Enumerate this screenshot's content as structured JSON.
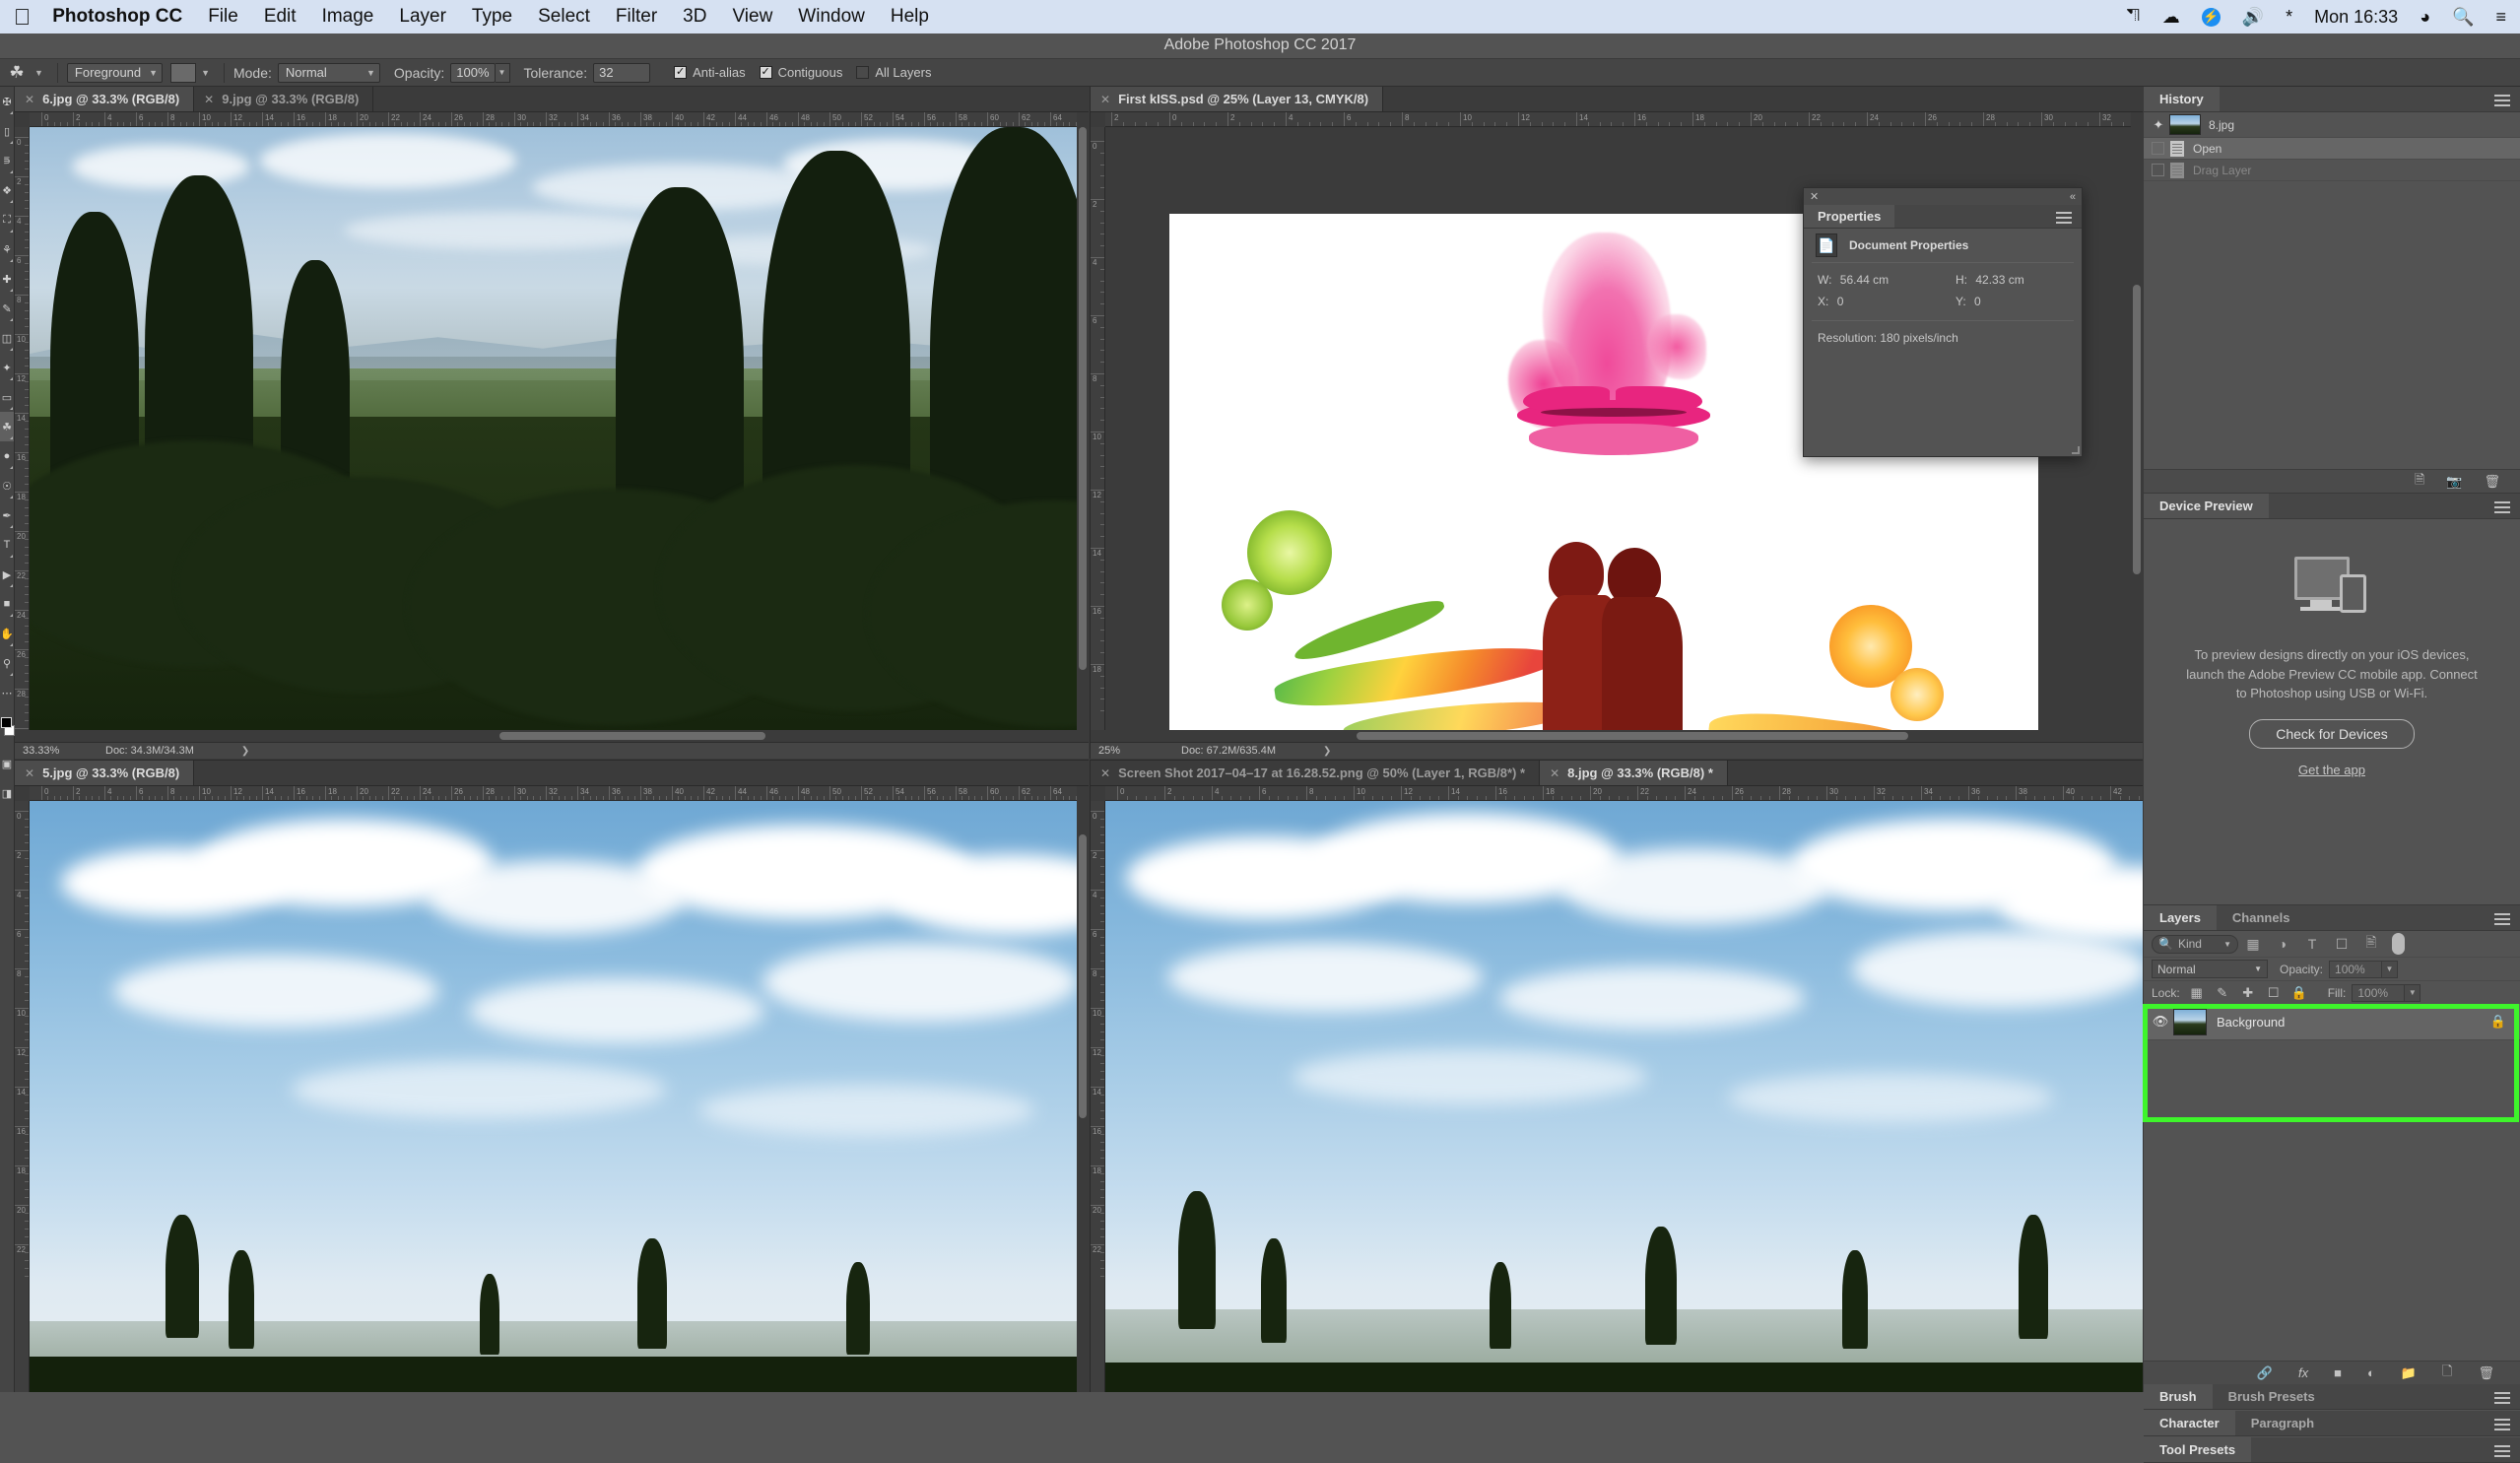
{
  "macbar": {
    "apple_icon": "apple-icon",
    "app_name": "Photoshop CC",
    "menus": [
      "File",
      "Edit",
      "Image",
      "Layer",
      "Type",
      "Select",
      "Filter",
      "3D",
      "View",
      "Window",
      "Help"
    ],
    "status_icons": [
      "do-not-disturb-icon",
      "creative-cloud-icon",
      "bolt-icon",
      "volume-icon",
      "bluetooth-icon"
    ],
    "time": "Mon 16:33",
    "right_icons": [
      "wifi-icon",
      "search-icon",
      "control-center-icon"
    ]
  },
  "titlebar": {
    "title": "Adobe Photoshop CC 2017"
  },
  "options_bar": {
    "tool_icon": "paint-bucket-icon",
    "fill_source": "Foreground",
    "mode_label": "Mode:",
    "mode_value": "Normal",
    "opacity_label": "Opacity:",
    "opacity_value": "100%",
    "tolerance_label": "Tolerance:",
    "tolerance_value": "32",
    "checkboxes": [
      {
        "label": "Anti-alias",
        "checked": true
      },
      {
        "label": "Contiguous",
        "checked": true
      },
      {
        "label": "All Layers",
        "checked": false
      }
    ]
  },
  "toolbar": {
    "tools": [
      "move-tool",
      "marquee-tool",
      "lasso-tool",
      "quick-selection-tool",
      "crop-tool",
      "eyedropper-tool",
      "healing-brush-tool",
      "brush-tool",
      "clone-stamp-tool",
      "history-brush-tool",
      "eraser-tool",
      "gradient-tool",
      "blur-tool",
      "dodge-tool",
      "pen-tool",
      "type-tool",
      "path-selection-tool",
      "shape-tool",
      "hand-tool",
      "zoom-tool"
    ],
    "selected_tool": "paint-bucket-tool",
    "foreground_color": "#000000",
    "background_color": "#ffffff"
  },
  "documents": {
    "group_tl": {
      "tabs": [
        {
          "label": "6.jpg @ 33.3% (RGB/8)",
          "active": true
        },
        {
          "label": "9.jpg @ 33.3% (RGB/8)",
          "active": false
        }
      ],
      "status": {
        "zoom": "33.33%",
        "doc": "Doc: 34.3M/34.3M"
      },
      "ruler_h": [
        "0",
        "2",
        "4",
        "6",
        "8",
        "10",
        "12",
        "14",
        "16",
        "18",
        "20",
        "22",
        "24",
        "26",
        "28",
        "30",
        "32",
        "34",
        "36",
        "38",
        "40",
        "42",
        "44",
        "46",
        "48",
        "50",
        "52",
        "54",
        "56",
        "58",
        "60",
        "62",
        "64"
      ],
      "ruler_v": [
        "0",
        "2",
        "4",
        "6",
        "8",
        "10",
        "12",
        "14",
        "16",
        "18",
        "20",
        "22",
        "24",
        "26",
        "28",
        "30"
      ]
    },
    "group_tr": {
      "tabs": [
        {
          "label": "First kISS.psd @ 25% (Layer 13, CMYK/8)",
          "active": true
        }
      ],
      "status": {
        "zoom": "25%",
        "doc": "Doc: 67.2M/635.4M"
      },
      "ruler_h": [
        "2",
        "0",
        "2",
        "4",
        "6",
        "8",
        "10",
        "12",
        "14",
        "16",
        "18",
        "20",
        "22",
        "24",
        "26",
        "28",
        "30",
        "32"
      ],
      "ruler_v": [
        "0",
        "2",
        "4",
        "6",
        "8",
        "10",
        "12",
        "14",
        "16",
        "18"
      ]
    },
    "group_bl": {
      "tabs": [
        {
          "label": "5.jpg @ 33.3% (RGB/8)",
          "active": true
        }
      ],
      "ruler_h": [
        "0",
        "2",
        "4",
        "6",
        "8",
        "10",
        "12",
        "14",
        "16",
        "18",
        "20",
        "22",
        "24",
        "26",
        "28",
        "30",
        "32",
        "34",
        "36",
        "38",
        "40",
        "42",
        "44",
        "46",
        "48",
        "50",
        "52",
        "54",
        "56",
        "58",
        "60",
        "62",
        "64"
      ],
      "ruler_v": [
        "0",
        "2",
        "4",
        "6",
        "8",
        "10",
        "12",
        "14",
        "16",
        "18",
        "20",
        "22"
      ]
    },
    "group_br": {
      "tabs": [
        {
          "label": "Screen Shot 2017–04–17 at 16.28.52.png @ 50% (Layer 1, RGB/8*) *",
          "active": false
        },
        {
          "label": "8.jpg @ 33.3% (RGB/8) *",
          "active": true
        }
      ],
      "ruler_h": [
        "0",
        "2",
        "4",
        "6",
        "8",
        "10",
        "12",
        "14",
        "16",
        "18",
        "20",
        "22",
        "24",
        "26",
        "28",
        "30",
        "32",
        "34",
        "36",
        "38",
        "40",
        "42"
      ],
      "ruler_v": [
        "0",
        "2",
        "4",
        "6",
        "8",
        "10",
        "12",
        "14",
        "16",
        "18",
        "20",
        "22"
      ]
    }
  },
  "properties_panel": {
    "close_icon": "close-icon",
    "collapse_icon": "collapse-icon",
    "tab_label": "Properties",
    "menu_icon": "panel-menu-icon",
    "section_icon": "document-icon",
    "section_title": "Document Properties",
    "fields": [
      {
        "label": "W:",
        "value": "56.44 cm"
      },
      {
        "label": "H:",
        "value": "42.33 cm"
      },
      {
        "label": "X:",
        "value": "0"
      },
      {
        "label": "Y:",
        "value": "0"
      }
    ],
    "resolution": "Resolution: 180 pixels/inch"
  },
  "history_panel": {
    "tab_label": "History",
    "menu_icon": "panel-menu-icon",
    "snapshot": {
      "icon": "history-brush-icon",
      "label": "8.jpg"
    },
    "states": [
      {
        "label": "Open",
        "selected": true,
        "dim": false
      },
      {
        "label": "Drag Layer",
        "selected": false,
        "dim": true
      }
    ],
    "footer_icons": [
      "new-document-from-state-icon",
      "new-snapshot-icon",
      "delete-icon"
    ]
  },
  "device_preview_panel": {
    "tab_label": "Device Preview",
    "menu_icon": "panel-menu-icon",
    "illustration": "monitor-and-tablet-icon",
    "description": "To preview designs directly on your iOS devices, launch the Adobe Preview CC mobile app. Connect to Photoshop using USB or Wi-Fi.",
    "button_label": "Check for Devices",
    "link_label": "Get the app"
  },
  "layers_panel": {
    "tabs": [
      {
        "label": "Layers",
        "active": true
      },
      {
        "label": "Channels",
        "active": false
      }
    ],
    "menu_icon": "panel-menu-icon",
    "filter": {
      "search_icon": "search-icon",
      "kind_label": "Kind",
      "filter_icons": [
        "pixel-filter-icon",
        "adjustment-filter-icon",
        "type-filter-icon",
        "shape-filter-icon",
        "smart-object-filter-icon"
      ],
      "toggle_icon": "filter-toggle-icon"
    },
    "blend": {
      "mode": "Normal",
      "opacity_label": "Opacity:",
      "opacity_value": "100%"
    },
    "lock": {
      "label": "Lock:",
      "icons": [
        "lock-transparent-pixels-icon",
        "lock-image-pixels-icon",
        "lock-position-icon",
        "lock-artboard-icon",
        "lock-all-icon"
      ],
      "fill_label": "Fill:",
      "fill_value": "100%"
    },
    "layers": [
      {
        "name": "Background",
        "visible": true,
        "locked": true,
        "selected": true,
        "lock_icon": "lock-icon",
        "eye_icon": "eye-icon"
      }
    ],
    "footer_icons": [
      "link-layers-icon",
      "layer-style-fx-icon",
      "layer-mask-icon",
      "adjustment-layer-icon",
      "new-group-icon",
      "new-layer-icon",
      "delete-layer-icon"
    ],
    "highlight_color": "#3ef52b"
  },
  "bottom_panels": [
    {
      "tabs": [
        "Brush",
        "Brush Presets"
      ],
      "menu_icon": "panel-menu-icon"
    },
    {
      "tabs": [
        "Character",
        "Paragraph"
      ],
      "menu_icon": "panel-menu-icon"
    },
    {
      "tabs": [
        "Tool Presets"
      ],
      "menu_icon": "panel-menu-icon"
    }
  ]
}
